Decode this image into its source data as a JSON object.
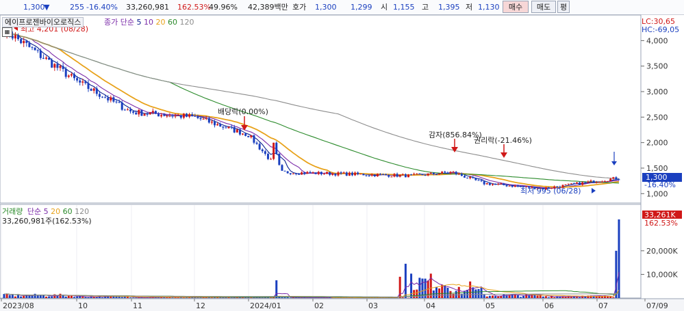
{
  "topbar": {
    "price": "1,300",
    "change": "255",
    "change_pct": "-16.40%",
    "volume": "33,260,981",
    "volume_ratio": "162.53%",
    "turnover": "49.96%",
    "amount": "42,389백만",
    "ask_label": "호가",
    "ask1": "1,300",
    "bid1": "1,299",
    "open_label": "시",
    "open": "1,155",
    "high_label": "고",
    "high": "1,395",
    "low_label": "저",
    "low": "1,130",
    "buy_label": "매수",
    "sell_label": "매도",
    "eval_label": "평"
  },
  "price_panel": {
    "stock_name": "에이프로젠바이오로직스",
    "ma_label": "종가 단순",
    "ma_periods": [
      "5",
      "10",
      "20",
      "60",
      "120"
    ],
    "lc_label": "LC:30,65",
    "hc_label": "HC:-69,05",
    "max_label": "최고 4,201 (08/28)",
    "min_label": "최저 995 (06/28)",
    "annotations": {
      "dividend": "배당락(0.00%)",
      "capital_reduction": "감자(856.84%)",
      "rights": "권리락(-21.46%)"
    },
    "current_price_tag": "1,300",
    "current_change_tag": "-16.40%",
    "y_ticks": [
      "4,000",
      "3,500",
      "3,000",
      "2,500",
      "2,000",
      "1,500",
      "1,000"
    ]
  },
  "volume_panel": {
    "title": "거래량",
    "ma_label": "단순",
    "ma_periods": [
      "5",
      "20",
      "60",
      "120"
    ],
    "summary": "33,260,981주(162.53%)",
    "current_tag": "33,261K",
    "current_pct_tag": "162.53%",
    "y_ticks": [
      "20,000K",
      "10,000K"
    ]
  },
  "x_axis": [
    "2023/08",
    "10",
    "11",
    "12",
    "2024/01",
    "02",
    "03",
    "04",
    "05",
    "06",
    "07",
    "07/09"
  ],
  "colors": {
    "up": "#d01818",
    "down": "#1a3fbf",
    "ma5": "#0a1f8f",
    "ma10": "#7a2aa8",
    "ma20": "#e8a21a",
    "ma60": "#2a8a2a",
    "ma120": "#8c8c8c"
  },
  "chart_data": {
    "type": "candlestick",
    "xlabels": [
      "2023/08",
      "10",
      "11",
      "12",
      "2024/01",
      "02",
      "03",
      "04",
      "05",
      "06",
      "07"
    ],
    "series": [
      {
        "name": "종가",
        "values": [
          4201,
          3200,
          2600,
          2500,
          2150,
          1420,
          1350,
          1420,
          1200,
          1100,
          1300
        ]
      },
      {
        "name": "거래량",
        "values": [
          1500,
          800,
          500,
          400,
          600,
          300,
          9000,
          4000,
          1500,
          1000,
          33261
        ]
      }
    ],
    "ylim_price": [
      950,
      4300
    ],
    "ylim_volume": [
      0,
      35000
    ]
  }
}
